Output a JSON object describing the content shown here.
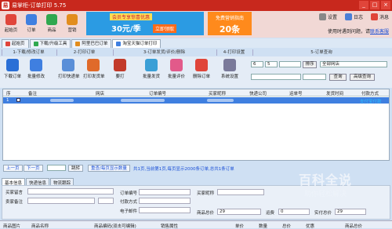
{
  "app": {
    "title": "易掌柜-订单打印 5.75",
    "icon_label": "易"
  },
  "window_controls": [
    "_",
    "□",
    "×"
  ],
  "toolbar1": {
    "buttons": [
      {
        "label": "起始页",
        "color": "#e0453a"
      },
      {
        "label": "订单",
        "color": "#3f7fe0"
      },
      {
        "label": "商品",
        "color": "#2fa84f"
      },
      {
        "label": "营销",
        "color": "#e28d1d"
      }
    ]
  },
  "banner1": {
    "tag": "会员专享惊喜优惠",
    "amount": "30元/季",
    "cta": "立即领取"
  },
  "banner2": {
    "line1": "免费营销指南",
    "line2": "20条"
  },
  "topright": {
    "settings": "设置",
    "log": "日志",
    "messages": "消息"
  },
  "help": {
    "text": "使用时遇到问题，请",
    "link": "联系客服"
  },
  "tabs": [
    {
      "label": "起始页",
      "active": false
    },
    {
      "label": "下载/升级工具",
      "active": false
    },
    {
      "label": "阿里巴巴订单",
      "active": false
    },
    {
      "label": "淘宝天猫订单打印",
      "active": true
    }
  ],
  "groups": [
    "1-下载/修改订单",
    "2-打印订单",
    "3-订单发货/评价/删除",
    "4-打印设置",
    "5-订单查询"
  ],
  "toolbar2": {
    "buttons": [
      {
        "label": "下载订单",
        "color": "#2a6fd6"
      },
      {
        "label": "批量修改",
        "color": "#3f7fe0"
      },
      {
        "label": "打印快递单",
        "color": "#5a8fd8"
      },
      {
        "label": "打印发货单",
        "color": "#e06a2a"
      },
      {
        "label": "要打",
        "color": "#c23a2a"
      },
      {
        "label": "批量发货",
        "color": "#3a9fd6"
      },
      {
        "label": "批量评价",
        "color": "#e25a8a"
      },
      {
        "label": "删除订单",
        "color": "#e0453a"
      },
      {
        "label": "系统设置",
        "color": "#7a7a9a"
      }
    ],
    "filters": {
      "sel1": "6",
      "sel2": "5",
      "sel3": "",
      "sort_label": "排序",
      "shop": "全部网店",
      "query_btn": "查询",
      "adv_query_btn": "高级查询"
    }
  },
  "grid": {
    "columns": [
      "序",
      "",
      "备注",
      "网店",
      "订单编号",
      "买家昵称",
      "快递公司",
      "运单号",
      "发货时间",
      "付款方式"
    ],
    "row": {
      "index": "1",
      "pay": "支付宝付款"
    }
  },
  "pager": {
    "prev": "上一页",
    "next": "下一页",
    "jump": "跳转",
    "show_all": "重查/每页显示数量",
    "info": "共1页,当前第1页,每页显示2000条订单,总共1条订单"
  },
  "detail_tabs": [
    {
      "label": "基本信息",
      "active": true
    },
    {
      "label": "快递信息",
      "active": false
    },
    {
      "label": "物流跟踪",
      "active": false
    }
  ],
  "detail": {
    "buyer_msg": "买家留言",
    "seller_note": "卖家备注",
    "order_no": "订单编号",
    "pay_method": "付款方式",
    "email": "电子邮件",
    "buyer_nick": "买家昵称",
    "goods_total": "商品总价",
    "goods_total_val": "29",
    "shipping": "运费",
    "shipping_val": "0",
    "paid": "实付总价",
    "paid_val": "29"
  },
  "bottom_head": [
    "商品图片",
    "商品名称",
    "商品编码(双击可编辑)",
    "销售属性",
    "单价",
    "数量",
    "总价",
    "优惠",
    "商品总价"
  ],
  "watermark": {
    "title": "百科全说",
    "sub": "助你轻松解决"
  }
}
